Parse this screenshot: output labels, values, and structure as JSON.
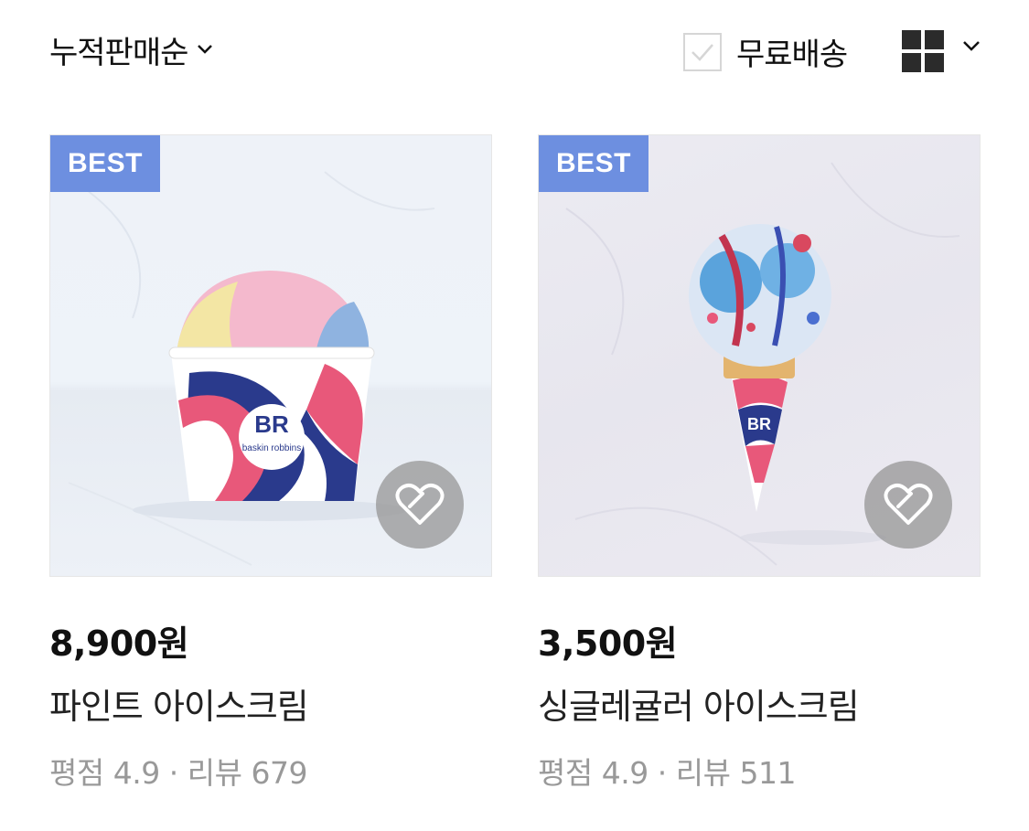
{
  "toolbar": {
    "sort_label": "누적판매순",
    "free_shipping_label": "무료배송",
    "free_shipping_checked": false,
    "sort_icon": "chevron-down-icon",
    "view_icon": "grid-view-icon"
  },
  "products": [
    {
      "badge": "BEST",
      "price": "8,900원",
      "name": "파인트 아이스크림",
      "rating_label": "평점",
      "rating": "4.9",
      "review_label": "리뷰",
      "reviews": "679",
      "image": "pint-ice-cream-cup"
    },
    {
      "badge": "BEST",
      "price": "3,500원",
      "name": "싱글레귤러 아이스크림",
      "rating_label": "평점",
      "rating": "4.9",
      "review_label": "리뷰",
      "reviews": "511",
      "image": "single-regular-cone"
    }
  ],
  "colors": {
    "badge_bg": "#6d8fe0",
    "brand_navy": "#2a3a8c",
    "brand_pink": "#e8587a"
  }
}
